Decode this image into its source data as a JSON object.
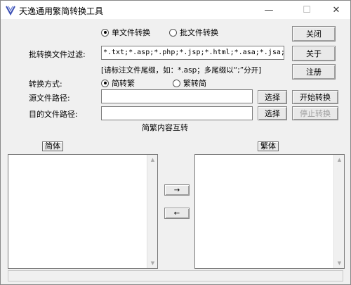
{
  "window": {
    "title": "天逸通用繁简转换工具",
    "minimize_glyph": "—",
    "maximize_glyph": "☐",
    "close_glyph": "✕"
  },
  "mode": {
    "single_label": "单文件转换",
    "batch_label": "批文件转换",
    "selected": "single"
  },
  "filter": {
    "label": "批转换文件过滤:",
    "value": "*.txt;*.asp;*.php;*.jsp;*.html;*.asa;*.jsa;*.vb",
    "hint": "[请标注文件尾缀，如：*.asp；多尾缀以“;”分开]"
  },
  "direction": {
    "label": "转换方式:",
    "s2t_label": "简转繁",
    "t2s_label": "繁转简",
    "selected": "s2t"
  },
  "source": {
    "label": "源文件路径:",
    "value": "",
    "browse_label": "选择"
  },
  "target": {
    "label": "目的文件路径:",
    "value": "",
    "browse_label": "选择"
  },
  "buttons": {
    "close": "关闭",
    "about": "关于",
    "register": "注册",
    "start": "开始转换",
    "stop": "停止转换",
    "to_right": "→",
    "to_left": "←"
  },
  "mutual": {
    "title": "简繁内容互转",
    "simplified_tag": "简体",
    "traditional_tag": "繁体",
    "simplified_text": "",
    "traditional_text": ""
  },
  "icons": {
    "app": "ribbon-v-icon",
    "scroll_up": "scroll-up-arrow-icon",
    "scroll_down": "scroll-down-arrow-icon"
  },
  "colors": {
    "app_icon": "#3b4fb5",
    "window_bg": "#f0f0f0",
    "disabled_text": "#a0a0a0"
  }
}
